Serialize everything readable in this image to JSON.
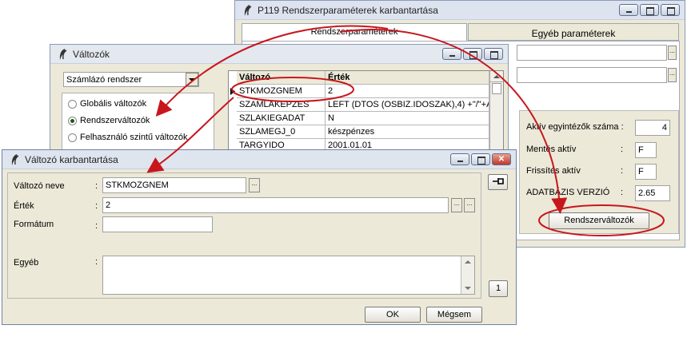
{
  "param_window": {
    "title": "P119 Rendszerparaméterek karbantartása",
    "tabs": [
      "Rendszerparaméterek",
      "Egyéb paraméterek"
    ],
    "fields": [
      {
        "label": "Aktív egyintézők száma :",
        "value": "4"
      },
      {
        "label": "Mentés aktív",
        "sep": ":",
        "value": "F"
      },
      {
        "label": "Frissítés aktív",
        "sep": ":",
        "value": "F"
      },
      {
        "label": "ADATBÁZIS VERZIÓ",
        "sep": ":",
        "value": "2.65"
      }
    ],
    "sysvars_button": "Rendszerváltozók"
  },
  "vars_window": {
    "title": "Változók",
    "system_select": "Számlázó rendszer",
    "radio_options": [
      "Globális változók",
      "Rendszerváltozók",
      "Felhasználó szintű változók"
    ],
    "selected_radio": "Rendszerváltozók",
    "grid": {
      "columns": [
        "Változó",
        "Érték"
      ],
      "rows": [
        [
          "STKMOZGNEM",
          "2"
        ],
        [
          "SZAMLAKEPZES",
          "LEFT (DTOS (OSBIZ.IDOSZAK),4) +\"/\"+A"
        ],
        [
          "SZLAKIEGADAT",
          "N"
        ],
        [
          "SZLAMEGJ_0",
          "készpénzes"
        ],
        [
          "TARGYIDO",
          "2001.01.01"
        ]
      ]
    }
  },
  "edit_window": {
    "title": "Változó karbantartása",
    "fields": {
      "name_label": "Változó neve",
      "name_value": "STKMOZGNEM",
      "value_label": "Érték",
      "value_value": "2",
      "format_label": "Formátum",
      "format_value": "",
      "other_label": "Egyéb",
      "other_value": ""
    },
    "sep": ":",
    "dots": "...",
    "page_number": "1",
    "ok_label": "OK",
    "cancel_label": "Mégsem"
  },
  "colors": {
    "annotation": "#c8161d",
    "title_bar": "#dde4ef",
    "window_bg": "#ece9d8"
  }
}
